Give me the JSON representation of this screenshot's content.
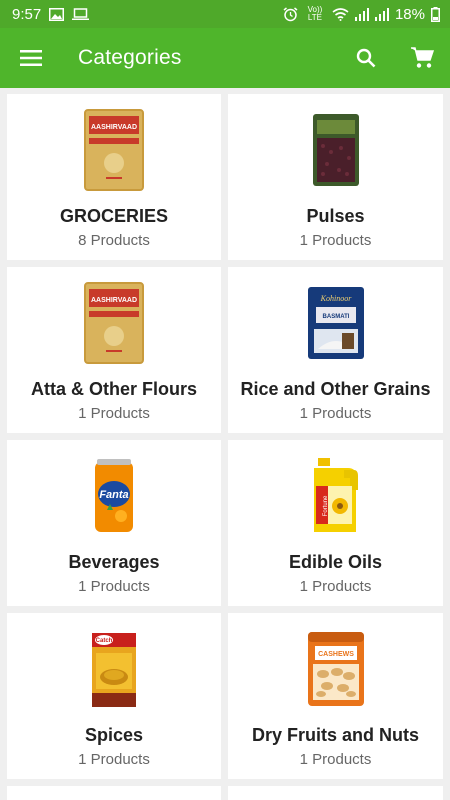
{
  "status": {
    "time": "9:57",
    "network": "Vo)) LTE",
    "battery": "18%"
  },
  "appbar": {
    "title": "Categories"
  },
  "categories": [
    {
      "name": "GROCERIES",
      "count": "8 Products",
      "image": "atta-bag-image"
    },
    {
      "name": "Pulses",
      "count": "1 Products",
      "image": "pulses-pack-image"
    },
    {
      "name": "Atta & Other Flours",
      "count": "1 Products",
      "image": "atta-bag-image"
    },
    {
      "name": "Rice and Other Grains",
      "count": "1 Products",
      "image": "rice-bag-image"
    },
    {
      "name": "Beverages",
      "count": "1 Products",
      "image": "fanta-can-image"
    },
    {
      "name": "Edible Oils",
      "count": "1 Products",
      "image": "oil-can-image"
    },
    {
      "name": "Spices",
      "count": "1 Products",
      "image": "spice-box-image"
    },
    {
      "name": "Dry Fruits and Nuts",
      "count": "1 Products",
      "image": "cashew-pack-image"
    }
  ],
  "colors": {
    "primary": "#4fb52b",
    "status_bar": "#4fa92a",
    "background": "#efefef"
  }
}
